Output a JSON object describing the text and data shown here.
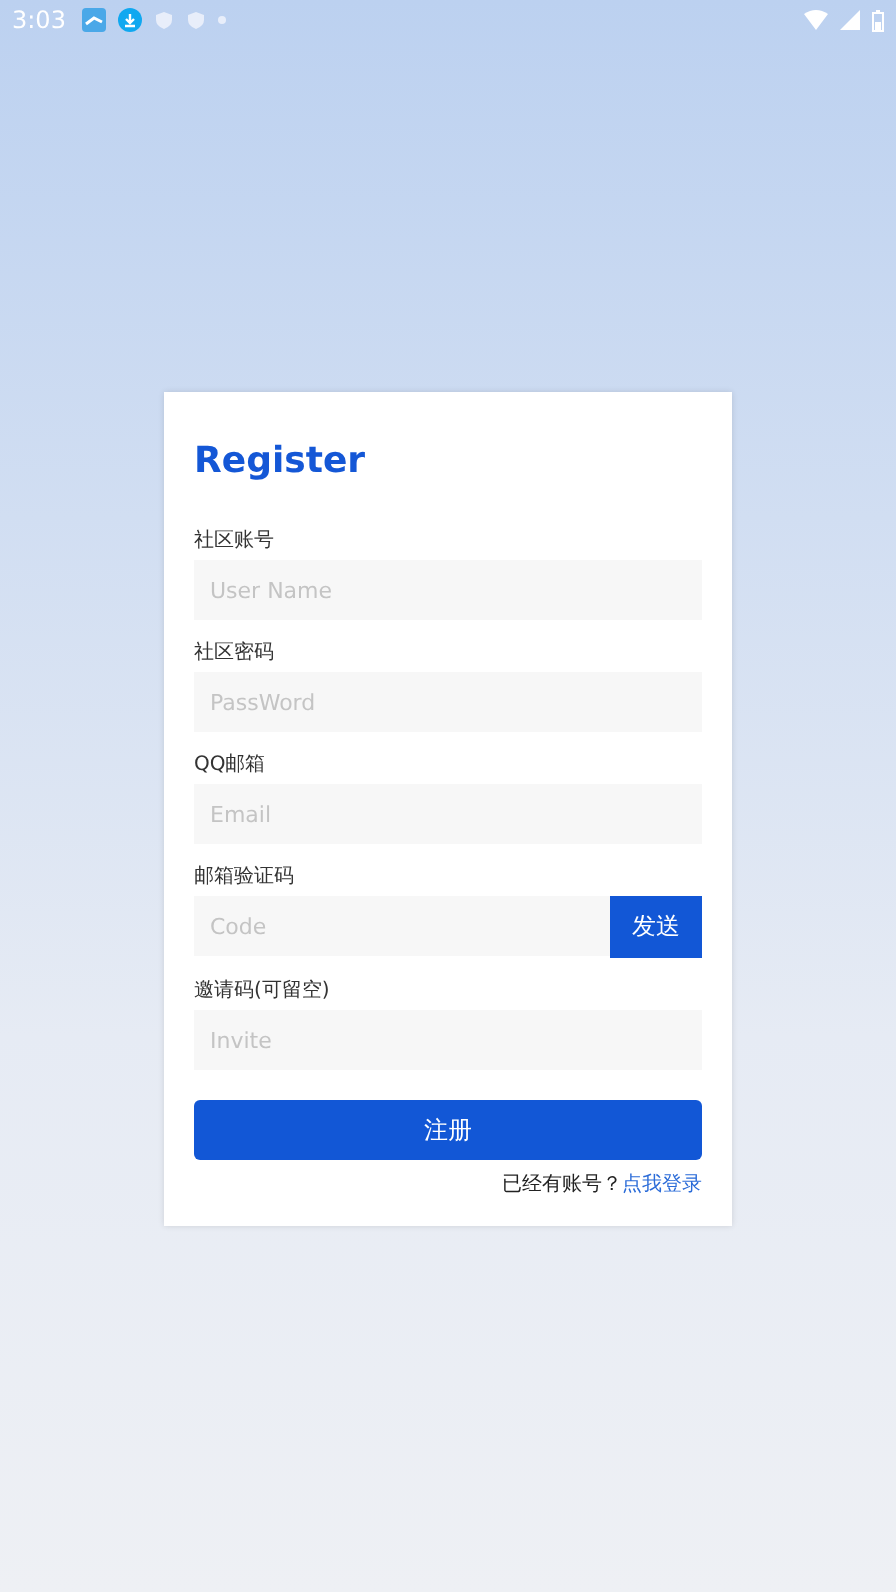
{
  "status_bar": {
    "time": "3:03"
  },
  "form": {
    "title": "Register",
    "fields": [
      {
        "label": "社区账号",
        "placeholder": "User Name",
        "kind": "text"
      },
      {
        "label": "社区密码",
        "placeholder": "PassWord",
        "kind": "text"
      },
      {
        "label": "QQ邮箱",
        "placeholder": "Email",
        "kind": "text"
      },
      {
        "label": "邮箱验证码",
        "placeholder": "Code",
        "kind": "code",
        "button": "发送"
      },
      {
        "label": "邀请码(可留空)",
        "placeholder": "Invite",
        "kind": "text"
      }
    ],
    "submit": "注册",
    "login_prompt": "已经有账号？",
    "login_link": "点我登录"
  }
}
